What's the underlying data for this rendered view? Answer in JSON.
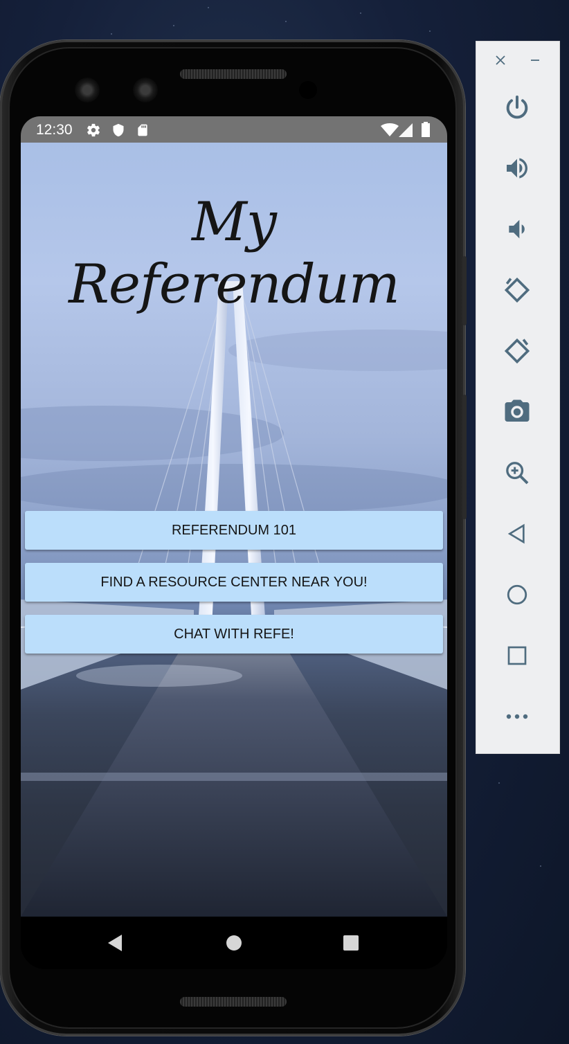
{
  "app": {
    "title": "My Referendum",
    "buttons": [
      {
        "label": "REFERENDUM 101"
      },
      {
        "label": "FIND A RESOURCE CENTER NEAR YOU!"
      },
      {
        "label": "CHAT WITH REFE!"
      }
    ]
  },
  "statusbar": {
    "time": "12:30",
    "left_icons": [
      "gear-icon",
      "shield-icon",
      "sd-card-icon"
    ],
    "right_icons": [
      "wifi-icon",
      "signal-icon",
      "battery-icon"
    ]
  },
  "navbar": {
    "items": [
      "back-icon",
      "home-icon",
      "recents-icon"
    ]
  },
  "emulator_toolbar": {
    "window_controls": [
      "close-icon",
      "minimize-icon"
    ],
    "items": [
      "power-icon",
      "volume-up-icon",
      "volume-down-icon",
      "rotate-left-icon",
      "rotate-right-icon",
      "camera-icon",
      "zoom-icon",
      "back-icon",
      "home-icon",
      "overview-icon",
      "more-icon"
    ]
  },
  "colors": {
    "button_bg": "#bbdefb",
    "statusbar_bg": "#737373",
    "toolbar_bg": "#eeeff1",
    "toolbar_icon": "#4f6c7f"
  }
}
